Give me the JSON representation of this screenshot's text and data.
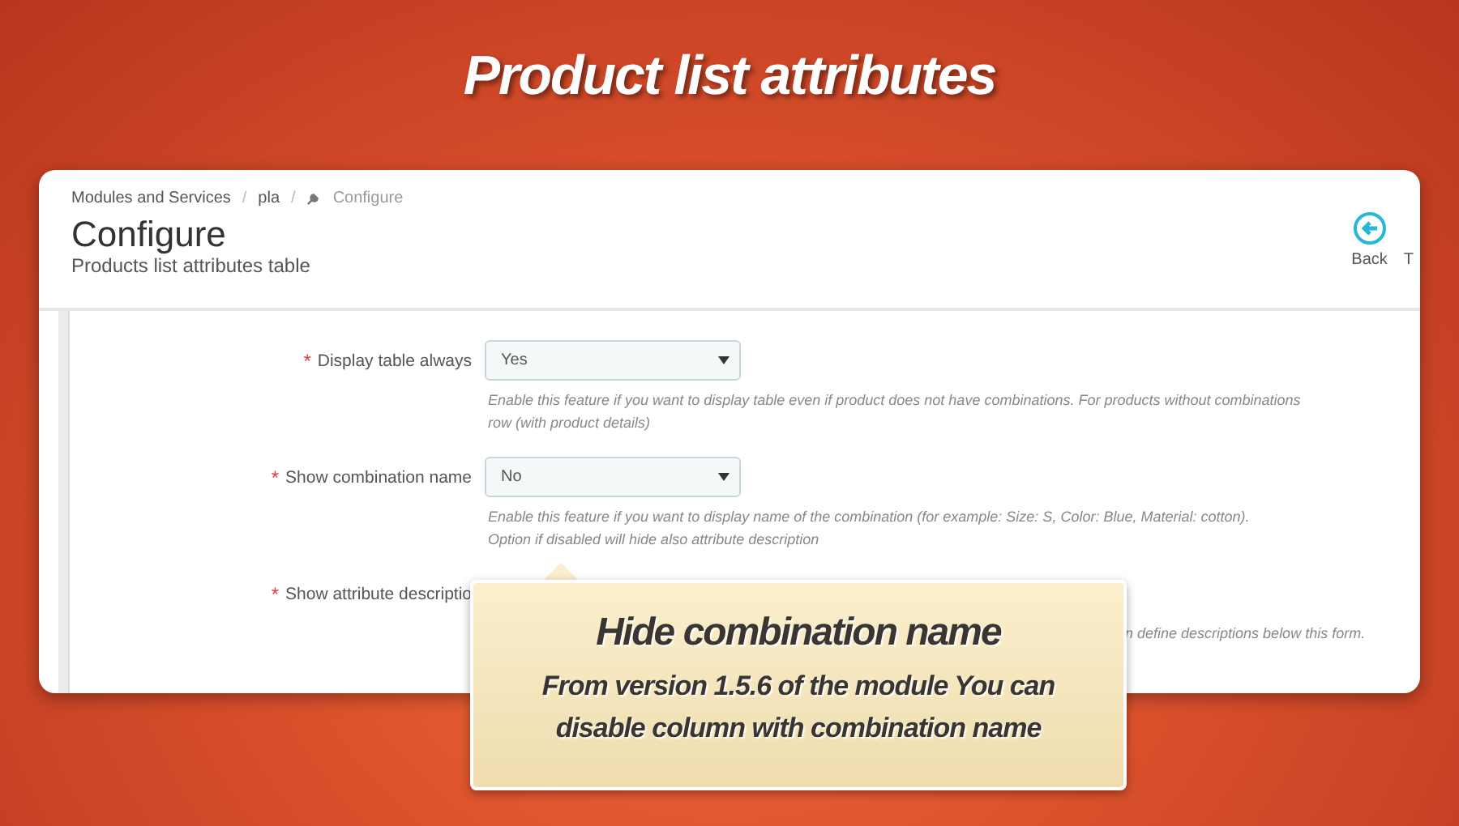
{
  "banner_title": "Product list attributes",
  "breadcrumb_separator": "/",
  "breadcrumb": [
    {
      "label": "Modules and Services",
      "kind": "link"
    },
    {
      "label": "pla",
      "kind": "link"
    },
    {
      "label": "Configure",
      "kind": "current"
    }
  ],
  "page_title": "Configure",
  "page_subtitle": "Products list attributes table",
  "toolbar": [
    {
      "label": "Back",
      "kind": "back"
    },
    {
      "label": "T",
      "kind": "text"
    }
  ],
  "form_rows": [
    {
      "mark": "*",
      "label": "Display table always",
      "kind": "select",
      "value": "Yes",
      "help": "Enable this feature if you want to display table even if product does not have combinations. For products without combinations\nrow (with product details)"
    },
    {
      "mark": "*",
      "label": "Show combination name",
      "kind": "select",
      "value": "No",
      "help": "Enable this feature if you want to display name of the combination (for example: Size: S, Color: Blue, Material: cotton).\nOption if disabled will hide also attribute description"
    },
    {
      "mark": "*",
      "label": "Show attribute descriptio",
      "kind": "covered",
      "help": "n define descriptions below this form."
    }
  ],
  "tooltip": {
    "title": "Hide combination name",
    "text": "From version 1.5.6 of the module You can\ndisable column with combination name"
  }
}
